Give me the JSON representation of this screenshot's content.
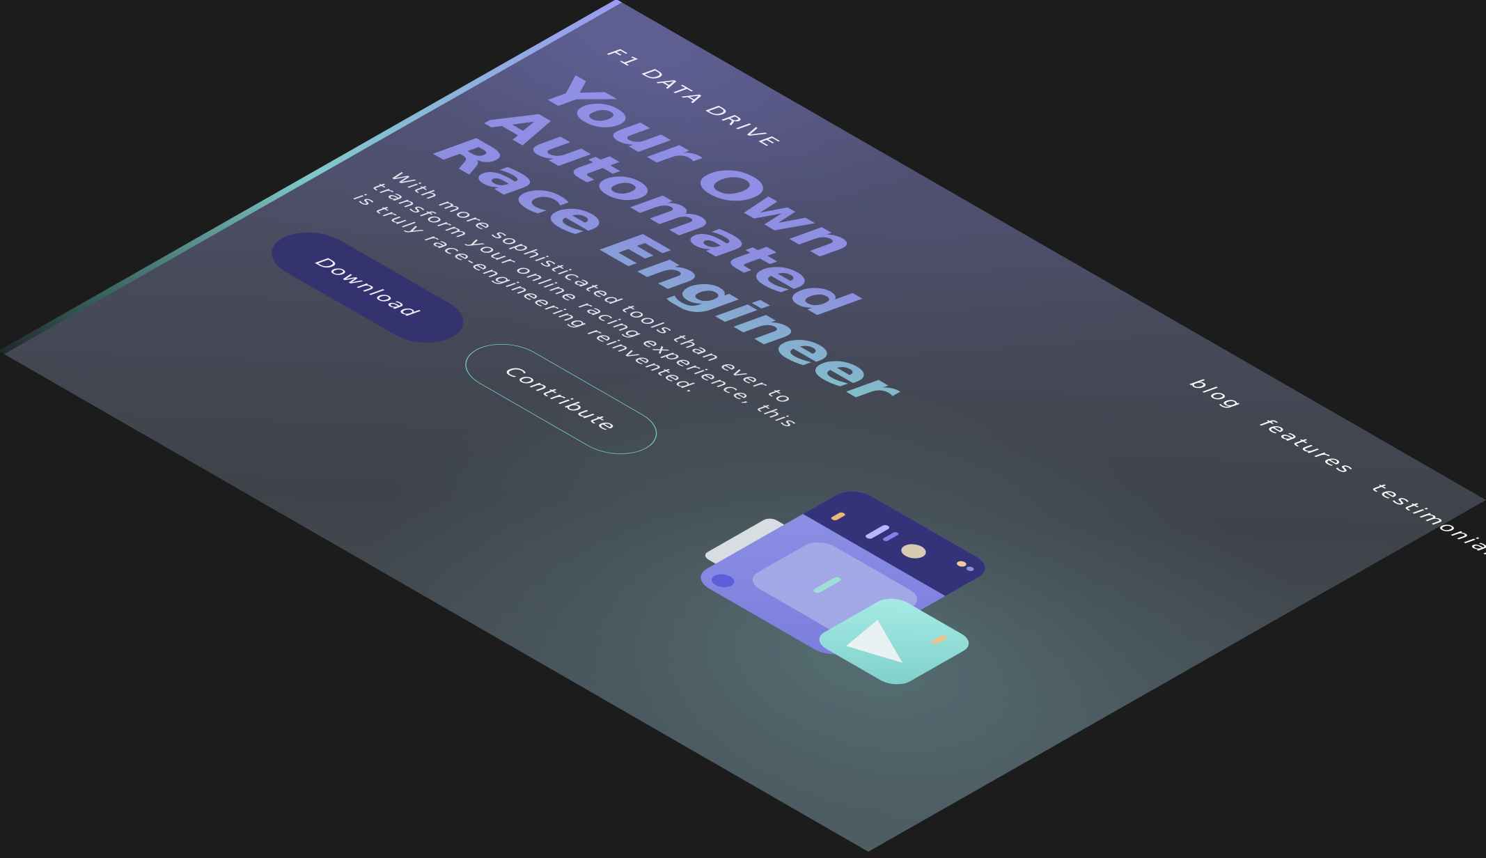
{
  "brand": {
    "logo": "F1 DATA DRIVE"
  },
  "nav": {
    "items": [
      "blog",
      "features",
      "testimonials"
    ]
  },
  "hero": {
    "headline_lines": [
      "Your Own",
      "Automated",
      "Race Engineer"
    ],
    "subtitle": "With more sophisticated tools than ever to transform your online racing experience, this is truly race-engineering reinvented.",
    "buttons": {
      "download": "Download",
      "contribute": "Contribute"
    }
  },
  "colors": {
    "background": "#1c1c1c",
    "accent_purple": "#8d8ee0",
    "accent_teal": "#7fc6c4",
    "button_primary": "#35336f"
  },
  "illustration": {
    "icon": "laptop-with-mail-icon"
  }
}
